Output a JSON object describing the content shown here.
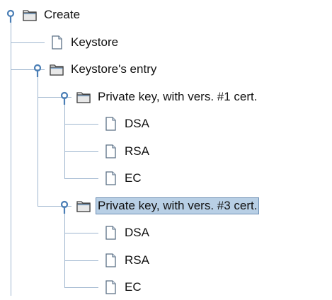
{
  "colors": {
    "tree_line": "#9fb6cf",
    "handle": "#4a7eb5",
    "selection_bg": "#b8cfe5",
    "selection_border": "#6b8db3"
  },
  "tree": [
    {
      "id": "create",
      "label": "Create",
      "icon": "folder-icon",
      "level": 0,
      "expanded": true,
      "selected": false
    },
    {
      "id": "keystore",
      "label": "Keystore",
      "icon": "document-icon",
      "level": 1,
      "expanded": null,
      "selected": false
    },
    {
      "id": "keystores-entry",
      "label": "Keystore's entry",
      "icon": "folder-icon",
      "level": 1,
      "expanded": true,
      "selected": false
    },
    {
      "id": "pk-v1",
      "label": "Private key, with vers. #1 cert.",
      "icon": "folder-icon",
      "level": 2,
      "expanded": true,
      "selected": false
    },
    {
      "id": "pk-v1-dsa",
      "label": "DSA",
      "icon": "document-icon",
      "level": 3,
      "expanded": null,
      "selected": false
    },
    {
      "id": "pk-v1-rsa",
      "label": "RSA",
      "icon": "document-icon",
      "level": 3,
      "expanded": null,
      "selected": false
    },
    {
      "id": "pk-v1-ec",
      "label": "EC",
      "icon": "document-icon",
      "level": 3,
      "expanded": null,
      "selected": false
    },
    {
      "id": "pk-v3",
      "label": "Private key, with vers. #3 cert.",
      "icon": "folder-icon",
      "level": 2,
      "expanded": true,
      "selected": true
    },
    {
      "id": "pk-v3-dsa",
      "label": "DSA",
      "icon": "document-icon",
      "level": 3,
      "expanded": null,
      "selected": false
    },
    {
      "id": "pk-v3-rsa",
      "label": "RSA",
      "icon": "document-icon",
      "level": 3,
      "expanded": null,
      "selected": false
    },
    {
      "id": "pk-v3-ec",
      "label": "EC",
      "icon": "document-icon",
      "level": 3,
      "expanded": null,
      "selected": false
    }
  ]
}
